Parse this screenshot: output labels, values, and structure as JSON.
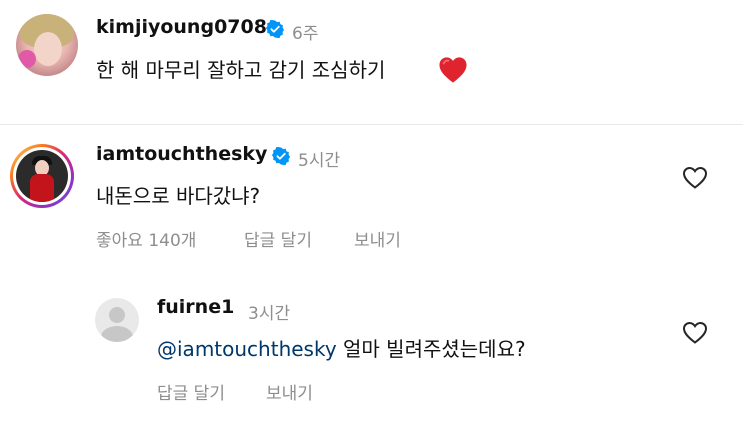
{
  "comments": [
    {
      "username": "kimjiyoung0708",
      "verified": true,
      "time": "6주",
      "text": "한 해 마무리 잘하고 감기 조심하기",
      "emoji": "red-heart"
    },
    {
      "username": "iamtouchthesky",
      "verified": true,
      "time": "5시간",
      "text": "내돈으로 바다갔냐?",
      "likes": "좋아요 140개",
      "reply_label": "답글 달기",
      "send_label": "보내기"
    },
    {
      "username": "fuirne1",
      "verified": false,
      "time": "3시간",
      "mention": "@iamtouchthesky",
      "text": " 얼마 빌려주셨는데요?",
      "reply_label": "답글 달기",
      "send_label": "보내기"
    }
  ],
  "colors": {
    "verified_badge": "#0095f6",
    "mention": "#00376b",
    "secondary_text": "#8e8e8e",
    "heart_emoji": "#e0242f"
  }
}
